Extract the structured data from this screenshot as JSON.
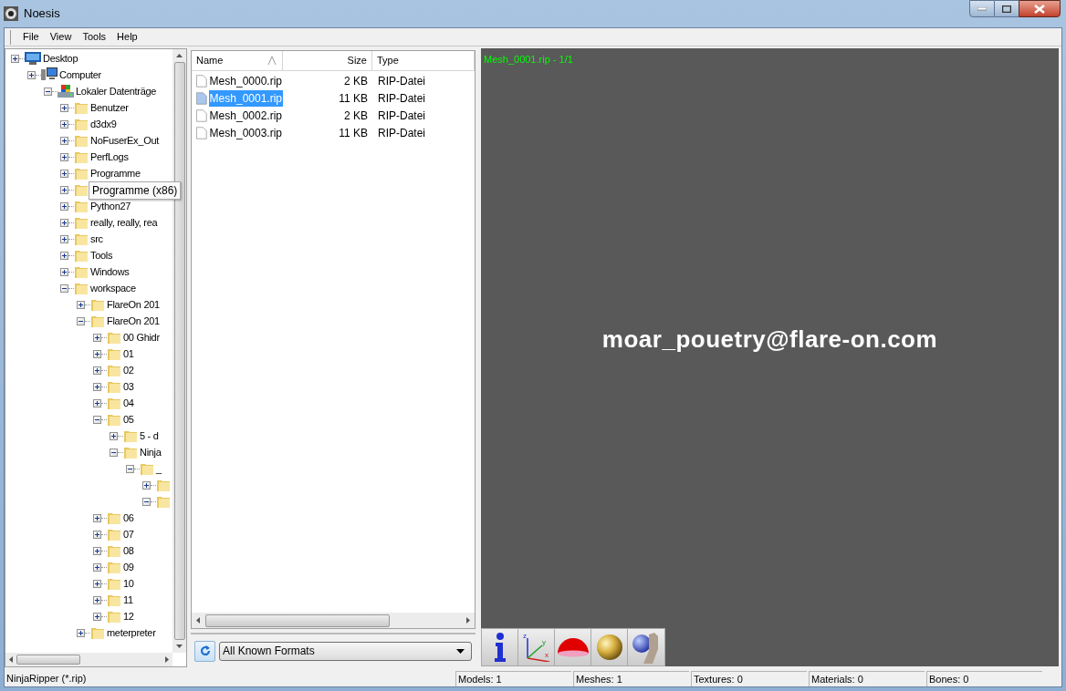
{
  "window": {
    "title": "Noesis"
  },
  "menu": [
    "File",
    "View",
    "Tools",
    "Help"
  ],
  "tree": [
    {
      "label": "Desktop",
      "expanded": false,
      "kind": "desktop",
      "children": [
        {
          "label": "Computer",
          "expanded": false,
          "kind": "computer",
          "children": [
            {
              "label": "Lokaler Datenträge",
              "expanded": true,
              "kind": "drive",
              "children": [
                {
                  "label": "Benutzer",
                  "expanded": false
                },
                {
                  "label": "d3dx9",
                  "expanded": false
                },
                {
                  "label": "NoFuserEx_Out",
                  "expanded": false
                },
                {
                  "label": "PerfLogs",
                  "expanded": false
                },
                {
                  "label": "Programme",
                  "expanded": false
                },
                {
                  "tooltip": "Programme (x86)",
                  "expanded": false
                },
                {
                  "label": "Python27",
                  "expanded": false
                },
                {
                  "label": "really, really, rea",
                  "expanded": false
                },
                {
                  "label": "src",
                  "expanded": false
                },
                {
                  "label": "Tools",
                  "expanded": false
                },
                {
                  "label": "Windows",
                  "expanded": false
                },
                {
                  "label": "workspace",
                  "expanded": true,
                  "children": [
                    {
                      "label": "FlareOn 201",
                      "expanded": false
                    },
                    {
                      "label": "FlareOn 201",
                      "expanded": true,
                      "children": [
                        {
                          "label": "00 Ghidr",
                          "expanded": false
                        },
                        {
                          "label": "01",
                          "expanded": false
                        },
                        {
                          "label": "02",
                          "expanded": false
                        },
                        {
                          "label": "03",
                          "expanded": false
                        },
                        {
                          "label": "04",
                          "expanded": false
                        },
                        {
                          "label": "05",
                          "expanded": true,
                          "children": [
                            {
                              "label": "5 - d",
                              "expanded": false
                            },
                            {
                              "label": "Ninja",
                              "expanded": true,
                              "children": [
                                {
                                  "label": "_",
                                  "expanded": true,
                                  "children": [
                                    {
                                      "expanded": false
                                    },
                                    {
                                      "expanded": true
                                    }
                                  ]
                                }
                              ]
                            }
                          ]
                        },
                        {
                          "label": "06",
                          "expanded": false
                        },
                        {
                          "label": "07",
                          "expanded": false
                        },
                        {
                          "label": "08",
                          "expanded": false
                        },
                        {
                          "label": "09",
                          "expanded": false
                        },
                        {
                          "label": "10",
                          "expanded": false
                        },
                        {
                          "label": "11",
                          "expanded": false
                        },
                        {
                          "label": "12",
                          "expanded": false
                        }
                      ]
                    },
                    {
                      "label": "meterpreter",
                      "expanded": false
                    }
                  ]
                }
              ]
            }
          ]
        }
      ]
    }
  ],
  "files": {
    "columns": [
      "Name",
      "Size",
      "Type"
    ],
    "rows": [
      {
        "name": "Mesh_0000.rip",
        "size": "2 KB",
        "type": "RIP-Datei",
        "selected": false
      },
      {
        "name": "Mesh_0001.rip",
        "size": "11 KB",
        "type": "RIP-Datei",
        "selected": true
      },
      {
        "name": "Mesh_0002.rip",
        "size": "2 KB",
        "type": "RIP-Datei",
        "selected": false
      },
      {
        "name": "Mesh_0003.rip",
        "size": "11 KB",
        "type": "RIP-Datei",
        "selected": false
      }
    ]
  },
  "format_select": {
    "value": "All Known Formats"
  },
  "toolbar": {
    "axis_labels": [
      "z",
      "y",
      "x"
    ]
  },
  "viewport": {
    "caption": "Mesh_0001.rip - 1/1",
    "text": "moar_pouetry@flare-on.com"
  },
  "status_bar": {
    "left": "NinjaRipper (*.rip)",
    "panels": [
      "Models: 1",
      "Meshes: 1",
      "Textures: 0",
      "Materials: 0",
      "Bones: 0"
    ]
  }
}
